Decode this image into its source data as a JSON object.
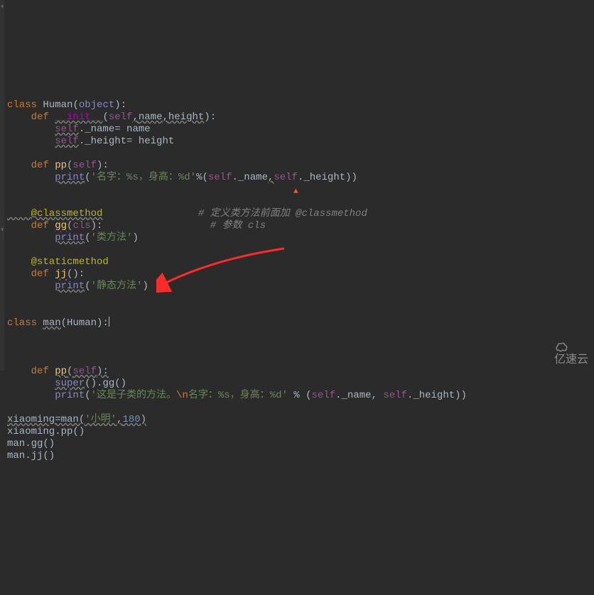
{
  "code": {
    "l1_class": "class ",
    "l1_Human": "Human",
    "l1_open": "(",
    "l1_obj": "object",
    "l1_close": "):",
    "l2_def": "    def ",
    "l2_init": "__init__",
    "l2_open": "(",
    "l2_self": "self",
    "l2_c1": ",",
    "l2_name": "name",
    "l2_c2": ",",
    "l2_height": "height",
    "l2_close": "):",
    "l3a": "        ",
    "l3_self": "self",
    "l3b": "._name= name",
    "l4a": "        ",
    "l4_self": "self",
    "l4b": "._height= height",
    "l5": "",
    "l6_def": "    def ",
    "l6_pp": "pp",
    "l6_open": "(",
    "l6_self": "self",
    "l6_close": "):",
    "l7a": "        ",
    "l7_print": "print",
    "l7_open": "(",
    "l7_str": "'名字：%s，身高：%d'",
    "l7_pc": "%(",
    "l7_self1": "self",
    "l7_m1": "._name",
    "l7_c": ",",
    "l7_self2": "self",
    "l7_m2": "._height))",
    "l8": "",
    "l9": "",
    "l10_deco": "    @classmethod",
    "l10_sp": "                ",
    "l10_c": "# 定义类方法前面加 @classmethod",
    "l11_def": "    def ",
    "l11_gg": "gg",
    "l11_open": "(",
    "l11_cls": "cls",
    "l11_close": "):",
    "l11_sp": "                  ",
    "l11_c": "# 参数 cls",
    "l12a": "        ",
    "l12_print": "print",
    "l12_open": "(",
    "l12_str": "'类方法'",
    "l12_close": ")",
    "l13": "",
    "l14_deco": "    @staticmethod",
    "l15_def": "    def ",
    "l15_jj": "jj",
    "l15_close": "():",
    "l16a": "        ",
    "l16_print": "print",
    "l16_open": "(",
    "l16_str": "'静态方法'",
    "l16_close": ")",
    "l17": "",
    "l18": "",
    "l19_class": "class ",
    "l19_man": "man",
    "l19_open": "(Human):",
    "l20": "",
    "l21": "",
    "l22": "",
    "l23_def": "    def ",
    "l23_pp": "pp",
    "l23_open": "(",
    "l23_self": "self",
    "l23_close": "):",
    "l24a": "        ",
    "l24_super": "super",
    "l24_mid": "().",
    "l24_gg": "gg",
    "l24_close": "()",
    "l25a": "        ",
    "l25_print": "print",
    "l25_open": "(",
    "l25_s1": "'这是子类的方法。",
    "l25_esc": "\\n",
    "l25_s2": "名字：%s，身高：%d'",
    "l25_pc": " % (",
    "l25_self1": "self",
    "l25_m1": "._name, ",
    "l25_self2": "self",
    "l25_m2": "._height))",
    "l26": "",
    "l27a": "xiaoming=man(",
    "l27_str": "'小明'",
    "l27_c": ",",
    "l27_num": "180",
    "l27_close": ")",
    "l28": "xiaoming.pp()",
    "l29": "man.gg()",
    "l30": "man.jj()"
  },
  "watermark_text": "亿速云"
}
